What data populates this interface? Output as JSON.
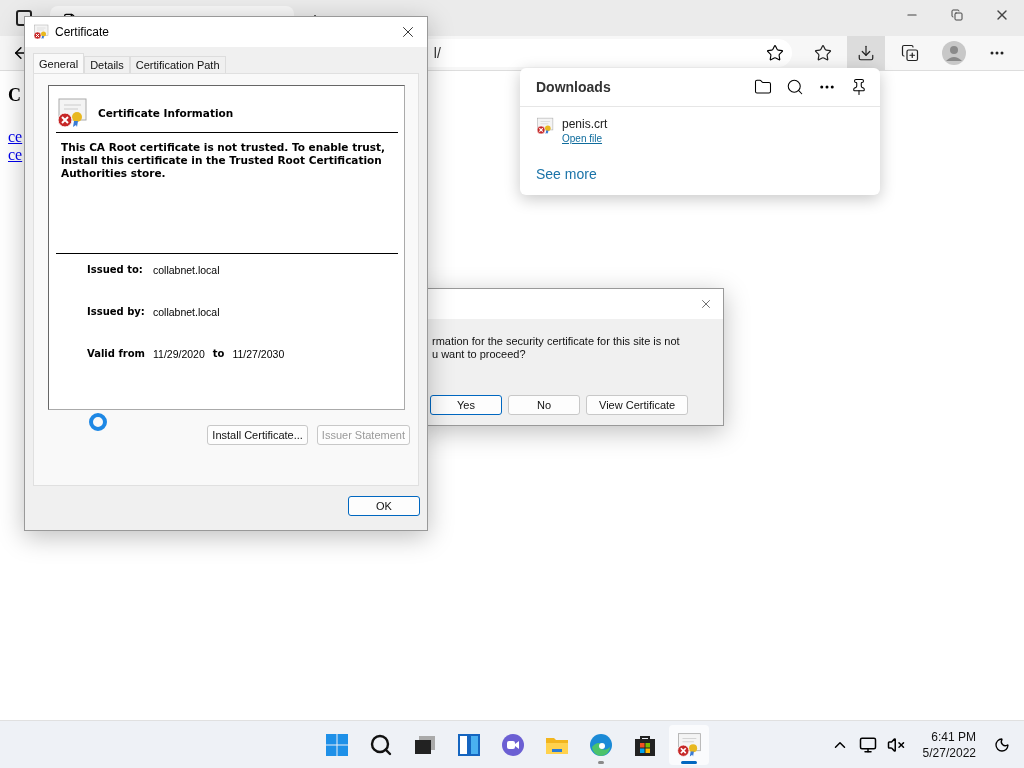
{
  "browser": {
    "address": "l/",
    "toolbar": [
      {
        "kind": "favorites",
        "selected": false
      },
      {
        "kind": "downloads",
        "selected": true
      },
      {
        "kind": "collections",
        "selected": false
      },
      {
        "kind": "profile",
        "selected": false
      },
      {
        "kind": "more",
        "selected": false
      }
    ],
    "page": {
      "heading": "C",
      "links": [
        "ce",
        "ce"
      ]
    }
  },
  "downloads": {
    "title": "Downloads",
    "items": [
      {
        "name": "penis.crt",
        "action": "Open file"
      }
    ],
    "see_more": "See more"
  },
  "security_dialog": {
    "message_lines": [
      "rmation for the security certificate for this site is not",
      "u want to proceed?"
    ],
    "buttons": [
      {
        "label": "Yes",
        "selected": true
      },
      {
        "label": "No",
        "selected": false
      },
      {
        "label": "View Certificate",
        "selected": false
      }
    ]
  },
  "certificate_dialog": {
    "title": "Certificate",
    "tabs": [
      {
        "label": "General",
        "selected": true
      },
      {
        "label": "Details",
        "selected": false
      },
      {
        "label": "Certification Path",
        "selected": false
      }
    ],
    "heading": "Certificate Information",
    "message": "This CA Root certificate is not trusted. To enable trust, install this certificate in the Trusted Root Certification Authorities store.",
    "fields": [
      {
        "label": "Issued to:",
        "value": "collabnet.local"
      },
      {
        "label": "Issued by:",
        "value": "collabnet.local"
      }
    ],
    "valid": {
      "label": "Valid from",
      "from": "11/29/2020",
      "to_label": "to",
      "to": "11/27/2030"
    },
    "buttons": [
      {
        "label": "Install Certificate...",
        "disabled": false
      },
      {
        "label": "Issuer Statement",
        "disabled": true
      }
    ],
    "ok": "OK"
  },
  "taskbar": {
    "apps": [
      {
        "kind": "start",
        "running": false,
        "active": false
      },
      {
        "kind": "search",
        "running": false,
        "active": false
      },
      {
        "kind": "taskview",
        "running": false,
        "active": false
      },
      {
        "kind": "widgets",
        "running": false,
        "active": false
      },
      {
        "kind": "chat",
        "running": false,
        "active": false
      },
      {
        "kind": "explorer",
        "running": false,
        "active": false
      },
      {
        "kind": "edge",
        "running": true,
        "active": false
      },
      {
        "kind": "store",
        "running": false,
        "active": false
      },
      {
        "kind": "certificate",
        "running": true,
        "active": true
      }
    ],
    "time": "6:41 PM",
    "date": "5/27/2022"
  }
}
